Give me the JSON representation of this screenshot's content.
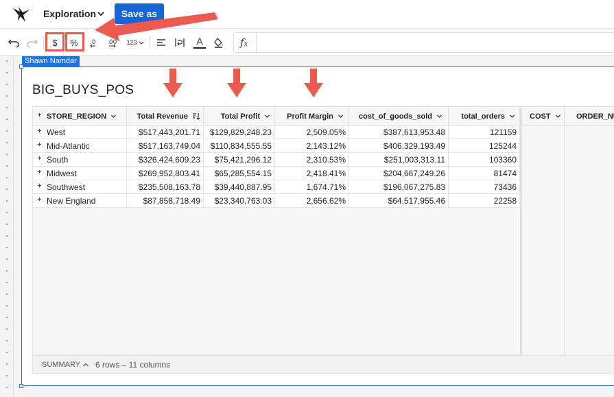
{
  "app": {
    "title": "Exploration",
    "save_label": "Save as"
  },
  "toolbar": {
    "undo_icon": "undo-icon",
    "redo_icon": "redo-icon",
    "currency_label": "$",
    "percent_label": "%",
    "number_format_label": "123",
    "text_color_label": "A",
    "formula_label": "f",
    "formula_sub": "x",
    "highlight_color": "#ef5a4f"
  },
  "canvas": {
    "user_tag": "Shawn Namdar",
    "table_title": "BIG_BUYS_POS",
    "accent_color": "#2e6fdb"
  },
  "table": {
    "columns": [
      "STORE_REGION",
      "Total Revenue",
      "Total Profit",
      "Profit Margin",
      "cost_of_goods_sold",
      "total_orders",
      "COST",
      "ORDER_NU"
    ],
    "rows": [
      [
        "West",
        "$517,443,201.71",
        "$129,829,248.23",
        "2,509.05%",
        "$387,613,953.48",
        "121159"
      ],
      [
        "Mid-Atlantic",
        "$517,163,749.04",
        "$110,834,555.55",
        "2,143.12%",
        "$406,329,193.49",
        "125244"
      ],
      [
        "South",
        "$326,424,609.23",
        "$75,421,296.12",
        "2,310.53%",
        "$251,003,313.11",
        "103360"
      ],
      [
        "Midwest",
        "$269,952,803.41",
        "$65,285,554.15",
        "2,418.41%",
        "$204,667,249.26",
        "81474"
      ],
      [
        "Southwest",
        "$235,508,163.78",
        "$39,440,887.95",
        "1,674.71%",
        "$196,067,275.83",
        "73436"
      ],
      [
        "New England",
        "$87,858,718.49",
        "$23,340,763.03",
        "2,656.62%",
        "$64,517,955.46",
        "22258"
      ]
    ]
  },
  "summary": {
    "label": "SUMMARY",
    "count": "6 rows – 11 columns"
  },
  "annotations": {
    "arrow_color": "#ef5a4f"
  }
}
